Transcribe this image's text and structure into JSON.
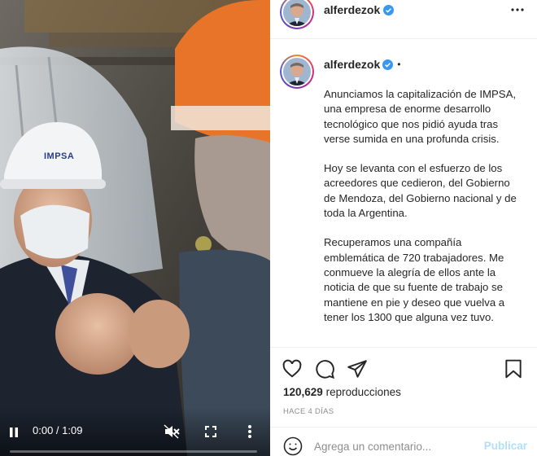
{
  "post": {
    "username": "alferdezok",
    "verified": true,
    "caption_paragraphs": [
      "Anunciamos la capitalización de IMPSA, una empresa de enorme desarrollo tecnológico que nos pidió ayuda tras verse sumida en una profunda crisis.",
      "Hoy se levanta con el esfuerzo de los acreedores que cedieron, del Gobierno de Mendoza, del Gobierno nacional y de toda la Argentina.",
      "Recuperamos una compañía emblemática de 720 trabajadores. Me conmueve la alegría de ellos ante la noticia de que su fuente de trabajo se mantiene en pie y deseo que vuelva a tener los 1300 que alguna vez tuvo."
    ],
    "views_count": "120,629",
    "views_label": "reproducciones",
    "timestamp": "HACE 4 DÍAS"
  },
  "video": {
    "time_display": "0:00 / 1:09",
    "progress": 0.0,
    "muted": true,
    "helmet_text": "IMPSA"
  },
  "comment": {
    "placeholder": "Agrega un comentario...",
    "publish_label": "Publicar"
  },
  "colors": {
    "verified": "#3897f0",
    "publish_disabled": "#b2dffc",
    "muted_text": "#8e8e8e"
  },
  "icons": {
    "play_pause": "pause-icon",
    "mute": "muted-speaker-icon",
    "fullscreen": "fullscreen-icon",
    "more": "more-vertical-icon",
    "options": "more-horizontal-icon",
    "like": "heart-icon",
    "comment": "comment-bubble-icon",
    "share": "paper-plane-icon",
    "save": "bookmark-icon",
    "emoji": "smiley-icon"
  }
}
